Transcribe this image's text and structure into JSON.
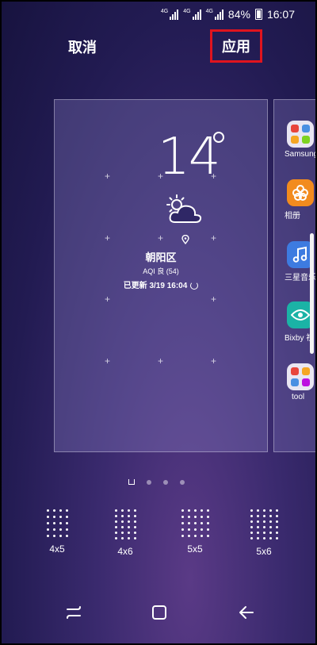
{
  "status_bar": {
    "net_label_1": "4G",
    "net_label_2": "4G",
    "net_label_3": "4G",
    "battery": "84%",
    "time": "16:07"
  },
  "top_bar": {
    "cancel_label": "取消",
    "apply_label": "应用"
  },
  "widget": {
    "temperature": "14",
    "district": "朝阳区",
    "aqi": "AQI 良 (54)",
    "updated": "已更新 3/19 16:04"
  },
  "next_page_apps": [
    {
      "label": "Samsung",
      "icon": "folder-icon"
    },
    {
      "label": "相册",
      "icon": "gallery-flower-icon"
    },
    {
      "label": "三星音乐",
      "icon": "music-note-icon"
    },
    {
      "label": "Bixby 视",
      "icon": "eye-icon"
    },
    {
      "label": "tool",
      "icon": "folder-icon"
    }
  ],
  "grid_options": [
    {
      "label": "4x5",
      "cols": 4,
      "rows": 5
    },
    {
      "label": "4x6",
      "cols": 4,
      "rows": 6
    },
    {
      "label": "5x5",
      "cols": 5,
      "rows": 5
    },
    {
      "label": "5x6",
      "cols": 5,
      "rows": 6
    }
  ],
  "colors": {
    "highlight_border": "#e0141e",
    "background_top": "#17133f",
    "background_bottom": "#5a3a86"
  }
}
